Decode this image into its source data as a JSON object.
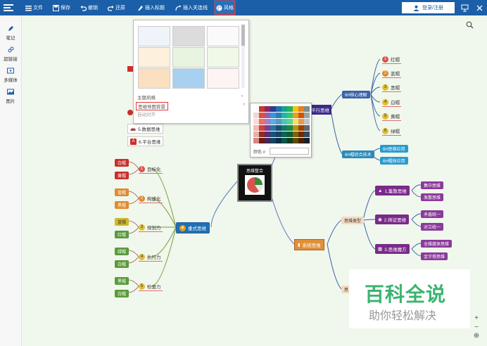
{
  "toolbar": {
    "items": [
      {
        "label": "文件",
        "icon": "menu-icon"
      },
      {
        "label": "保存",
        "icon": "save-icon"
      },
      {
        "label": "撤销",
        "icon": "undo-icon"
      },
      {
        "label": "还原",
        "icon": "redo-icon"
      },
      {
        "label": "插入标题",
        "icon": "insert-title-icon"
      },
      {
        "label": "插入关连线",
        "icon": "insert-link-line-icon"
      },
      {
        "label": "风格",
        "icon": "palette-icon"
      }
    ],
    "login_label": "登录/注册"
  },
  "sidebar": {
    "items": [
      {
        "label": "笔记"
      },
      {
        "label": "超链接"
      },
      {
        "label": "多媒体"
      },
      {
        "label": "图片"
      }
    ]
  },
  "style_menu": {
    "rows": [
      "主题风格",
      "思维导图背景",
      "自动对齐"
    ],
    "highlighted": "思维导图背景"
  },
  "color_picker": {
    "label": "颜色 #",
    "value": ""
  },
  "mindmap": {
    "center": "思维整合",
    "left_branch": "垂式思维",
    "left_items": [
      {
        "num": "1",
        "label": "目标化",
        "tags": [
          "白帽",
          "黄帽"
        ],
        "colors": [
          "#d9534f",
          "#d9534f"
        ]
      },
      {
        "num": "2",
        "label": "构建化",
        "tags": [
          "蓝帽",
          "黑帽"
        ],
        "colors": [
          "#e08a2e",
          "#e08a2e"
        ]
      },
      {
        "num": "3",
        "label": "规划力",
        "tags": [
          "蓝帽",
          "红帽"
        ],
        "colors": [
          "#e0c02e",
          "#d9534f"
        ]
      },
      {
        "num": "4",
        "label": "执行力",
        "tags": [
          "绿帽",
          "白帽"
        ],
        "colors": [
          "#7ab648",
          "#7ab648"
        ]
      },
      {
        "num": "5",
        "label": "检查力",
        "tags": [
          "黑帽",
          "白帽"
        ],
        "colors": [
          "#7ab648",
          "#d9534f"
        ]
      }
    ],
    "top_left_leaves": [
      "5.数据思维",
      "6.平台思维"
    ],
    "right_top_branch": "平行思维",
    "hat_group": "6H核心理解",
    "hats": [
      {
        "num": "1",
        "label": "红帽"
      },
      {
        "num": "2",
        "label": "蓝帽"
      },
      {
        "num": "3",
        "label": "黑帽"
      },
      {
        "num": "4",
        "label": "白帽"
      },
      {
        "num": "5",
        "label": "黄帽"
      },
      {
        "num": "6",
        "label": "绿帽"
      }
    ],
    "tech_group": "6H帽综合技术",
    "tech_items": [
      "6H思维应用",
      "6H帽体应用"
    ],
    "right_bottom_branch": "系统思维",
    "system_group": "思维类型",
    "system_items": [
      {
        "label": "1.集散思维",
        "children": [
          "集中思维",
          "发散思维"
        ]
      },
      {
        "label": "2.辩证思维",
        "children": [
          "矛盾统一",
          "对立统一"
        ]
      },
      {
        "label": "3.思维魔方",
        "children": [
          "全维度体思维",
          "金字塔思维"
        ]
      }
    ],
    "bottom_stub": "思"
  },
  "watermark": {
    "big": "百科全说",
    "small": "助你轻松解决"
  },
  "zoom": {
    "plus": "+",
    "minus": "−",
    "fit": "⊕"
  }
}
